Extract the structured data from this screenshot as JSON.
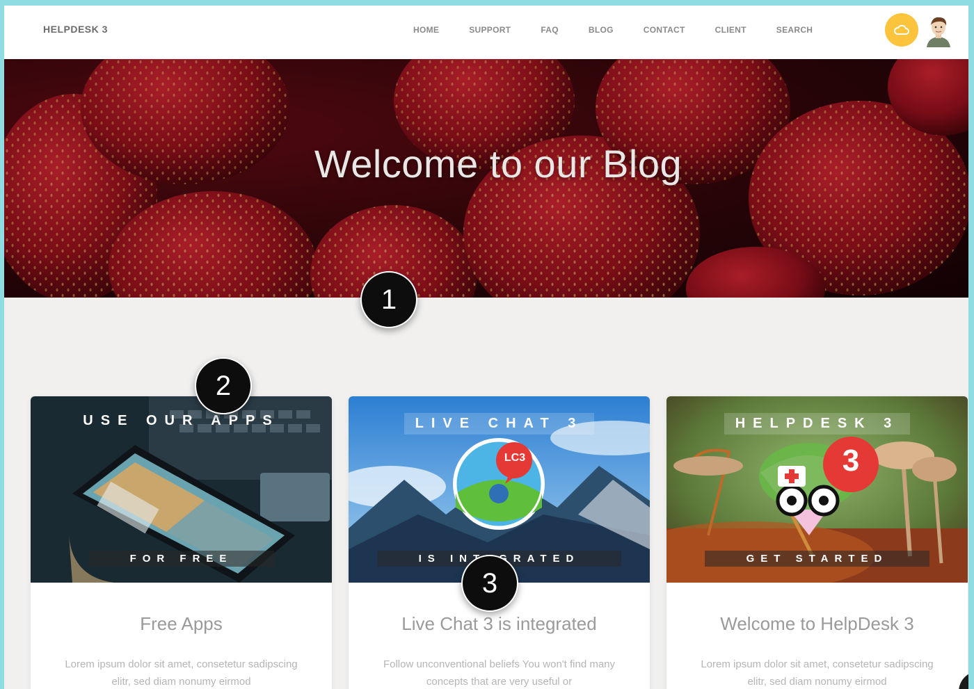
{
  "nav": {
    "brand": "HELPDESK 3",
    "items": [
      "HOME",
      "SUPPORT",
      "FAQ",
      "BLOG",
      "CONTACT",
      "CLIENT",
      "SEARCH"
    ],
    "accent_color": "#fcc33c"
  },
  "hero": {
    "title": "Welcome to our Blog"
  },
  "badges": [
    "1",
    "2",
    "3"
  ],
  "cards": [
    {
      "image_top": "USE OUR APPS",
      "image_bottom": "FOR FREE",
      "title": "Free Apps",
      "text": "Lorem ipsum dolor sit amet, consetetur sadipscing elitr, sed diam nonumy eirmod"
    },
    {
      "image_top": "LIVE CHAT 3",
      "image_bottom": "IS INTEGRATED",
      "logo_text": "LC3",
      "title": "Live Chat 3 is integrated",
      "text": "Follow unconventional beliefs You won't find many concepts that are very useful or"
    },
    {
      "image_top": "HELPDESK 3",
      "image_bottom": "GET STARTED",
      "logo_text": "3",
      "title": "Welcome to HelpDesk 3",
      "text": "Lorem ipsum dolor sit amet, consetetur sadipscing elitr, sed diam nonumy eirmod"
    }
  ]
}
